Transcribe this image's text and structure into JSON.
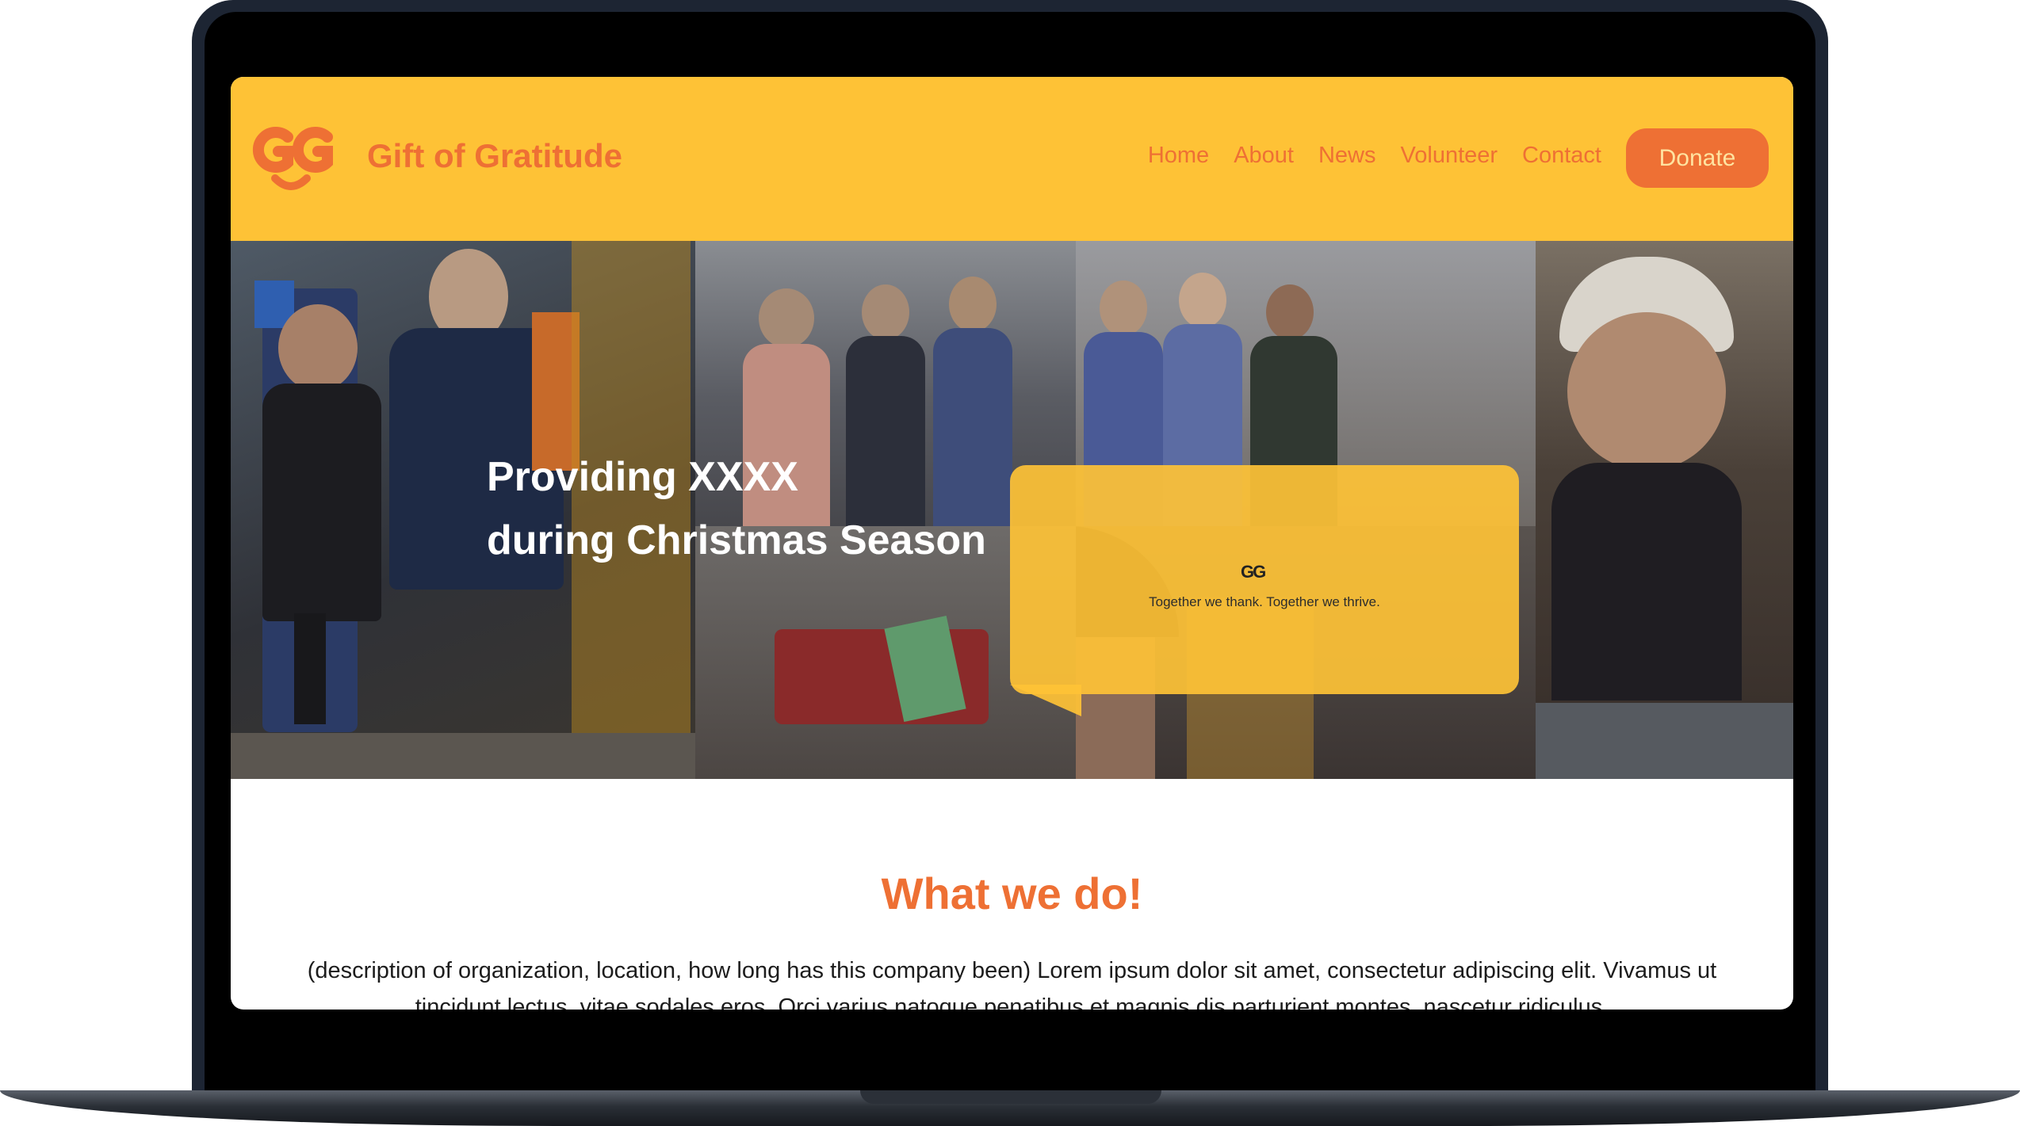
{
  "colors": {
    "accent": "#fec236",
    "brand": "#ee7034",
    "device_frame": "#1d2533"
  },
  "header": {
    "logo_icon": "gift-of-gratitude-logo",
    "brand_name": "Gift of Gratitude",
    "nav": [
      "Home",
      "About",
      "News",
      "Volunteer",
      "Contact"
    ],
    "donate_label": "Donate"
  },
  "hero": {
    "title_line1": "Providing XXXX",
    "title_line2": "during Christmas Season",
    "bubble": {
      "logo_text": "GG",
      "tagline": "Together we thank. Together we thrive."
    }
  },
  "about": {
    "heading": "What we do!",
    "body": "(description of organization, location, how long has this company been) Lorem ipsum dolor sit amet, consectetur adipiscing elit. Vivamus ut tincidunt lectus, vitae sodales eros. Orci varius natoque penatibus et magnis dis parturient montes, nascetur ridiculus."
  }
}
